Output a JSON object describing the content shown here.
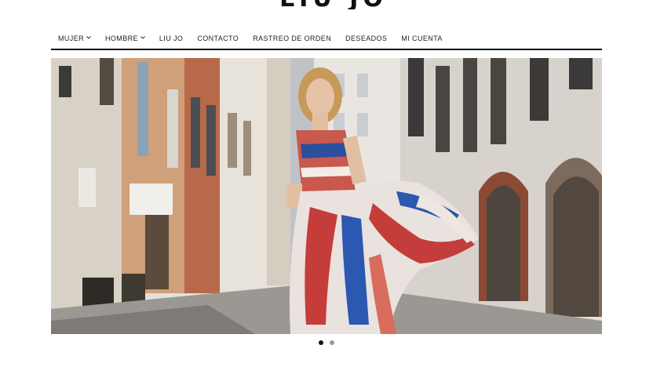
{
  "brand": {
    "logo_text": "LIU JO"
  },
  "nav": {
    "items": [
      {
        "label": "MUJER",
        "has_dropdown": true
      },
      {
        "label": "HOMBRE",
        "has_dropdown": true
      },
      {
        "label": "LIU JO",
        "has_dropdown": false
      },
      {
        "label": "CONTACTO",
        "has_dropdown": false
      },
      {
        "label": "RASTREO DE ORDEN",
        "has_dropdown": false
      },
      {
        "label": "DESEADOS",
        "has_dropdown": false
      },
      {
        "label": "MI CUENTA",
        "has_dropdown": false
      }
    ]
  },
  "hero": {
    "slide_count": 2,
    "active_slide": 1
  },
  "colors": {
    "text": "#222222",
    "rule": "#111111",
    "dot_active": "#111111",
    "dot_inactive": "#9a9a9a"
  }
}
